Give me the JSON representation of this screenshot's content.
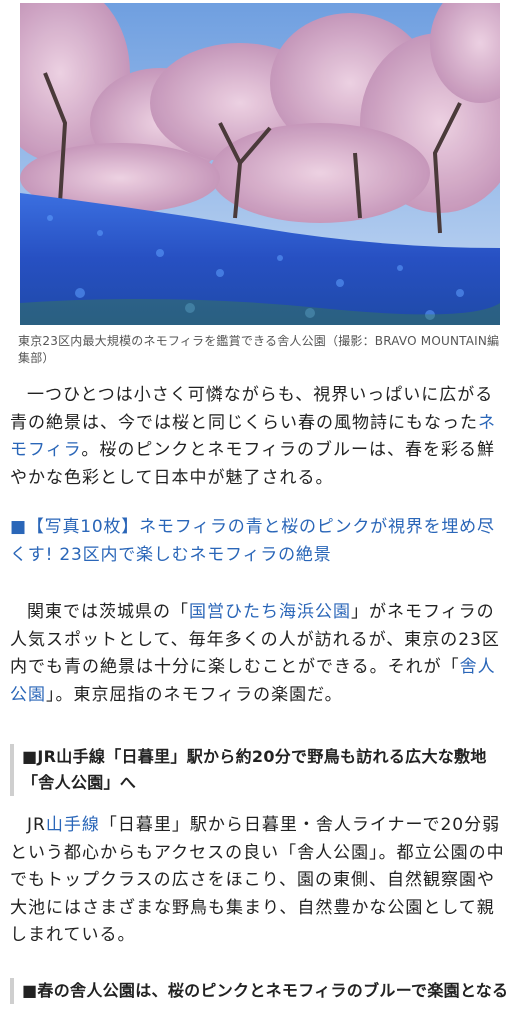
{
  "photo": {
    "alt": "cherry-blossoms-and-nemophila-photo"
  },
  "caption": "東京23区内最大規模のネモフィラを鑑賞できる舎人公園（撮影：BRAVO MOUNTAIN編集部）",
  "intro": {
    "text1": "一つひとつは小さく可憐ながらも、視界いっぱいに広がる青の絶景は、今では桜と同じくらい春の風物詩にもなった",
    "link1": "ネモフィラ",
    "text2": "。桜のピンクとネモフィラのブルーは、春を彩る鮮やかな色彩として日本中が魅了される。"
  },
  "related": {
    "marker": "■",
    "link": "【写真10枚】ネモフィラの青と桜のピンクが視界を埋め尽くす! 23区内で楽しむネモフィラの絶景"
  },
  "para2": {
    "text1": "関東では茨城県の「",
    "link1": "国営ひたち海浜公園",
    "text2": "」がネモフィラの人気スポットとして、毎年多くの人が訪れるが、東京の23区内でも青の絶景は十分に楽しむことができる。それが「",
    "link2": "舎人公園",
    "text3": "」。東京屈指のネモフィラの楽園だ。"
  },
  "heading1": "■JR山手線「日暮里」駅から約20分で野鳥も訪れる広大な敷地「舎人公園」へ",
  "para3": {
    "text1": "JR",
    "link1": "山手線",
    "text2": "「日暮里」駅から日暮里・舎人ライナーで20分弱という都心からもアクセスの良い「舎人公園」。都立公園の中でもトップクラスの広さをほこり、園の東側、自然観察園や大池にはさまざまな野鳥も集まり、自然豊かな公園として親しまれている。"
  },
  "heading2": "■春の舎人公園は、桜のピンクとネモフィラのブルーで楽園となる",
  "colors": {
    "link": "#2a66b8",
    "sky": "#8fb6e8",
    "nemophila": "#2f62d6",
    "sakura": "#e6b9cf"
  }
}
